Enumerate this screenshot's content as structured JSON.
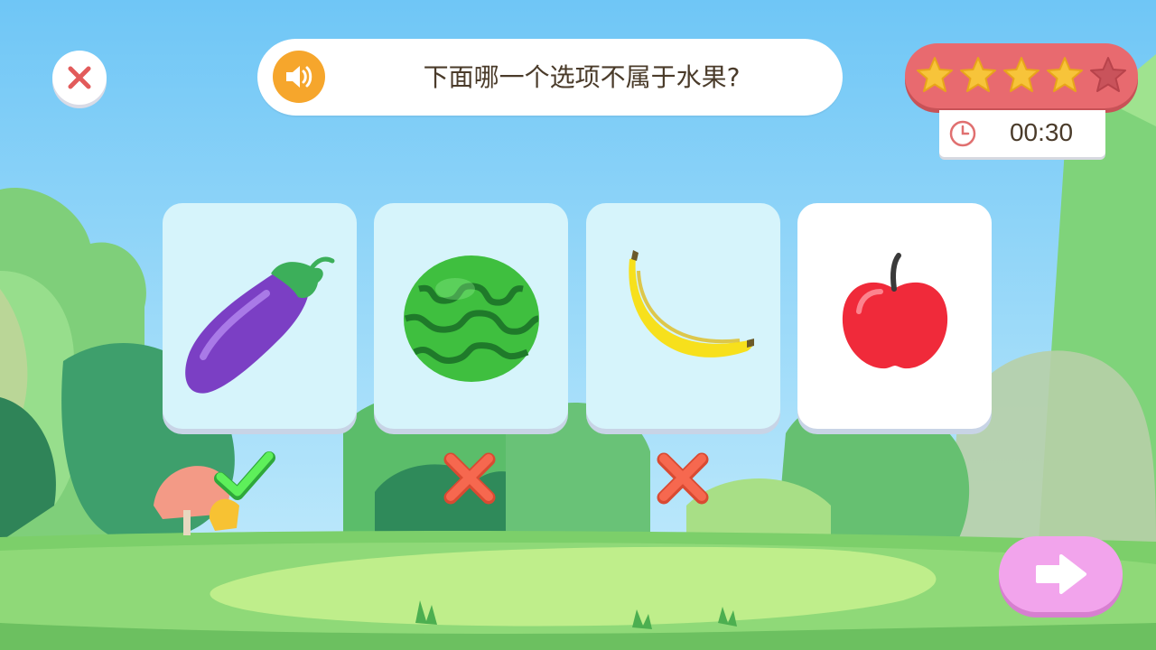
{
  "question": {
    "text": "下面哪一个选项不属于水果?"
  },
  "score": {
    "stars_filled": 4,
    "stars_total": 5
  },
  "timer": {
    "value": "00:30"
  },
  "options": [
    {
      "item": "eggplant-icon",
      "result": "correct"
    },
    {
      "item": "watermelon-icon",
      "result": "wrong"
    },
    {
      "item": "banana-icon",
      "result": "wrong"
    },
    {
      "item": "apple-icon",
      "result": "none"
    }
  ],
  "colors": {
    "sky": "#8fd3f8",
    "star_filled": "#f7c43a",
    "star_empty": "#c9535b",
    "score_panel": "#e86a6f",
    "speaker": "#f6a62c",
    "next_button": "#f2a4ec",
    "correct": "#3fdc3a",
    "wrong": "#f2614a"
  }
}
